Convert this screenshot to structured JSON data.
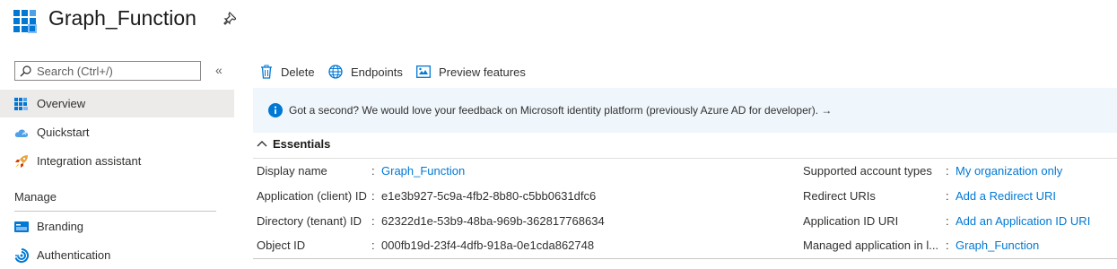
{
  "header": {
    "title": "Graph_Function"
  },
  "search": {
    "placeholder": "Search (Ctrl+/)"
  },
  "sidebar": {
    "items": [
      {
        "label": "Overview",
        "icon": "grid-icon",
        "active": true
      },
      {
        "label": "Quickstart",
        "icon": "cloud-icon"
      },
      {
        "label": "Integration assistant",
        "icon": "rocket-icon"
      }
    ],
    "manage_heading": "Manage",
    "manage_items": [
      {
        "label": "Branding",
        "icon": "branding-icon"
      },
      {
        "label": "Authentication",
        "icon": "authentication-icon"
      }
    ]
  },
  "toolbar": {
    "delete_label": "Delete",
    "endpoints_label": "Endpoints",
    "preview_label": "Preview features"
  },
  "banner": {
    "text": "Got a second? We would love your feedback on Microsoft identity platform (previously Azure AD for developer). →"
  },
  "essentials": {
    "heading": "Essentials",
    "left": [
      {
        "label": "Display name",
        "value": "Graph_Function",
        "link": true
      },
      {
        "label": "Application (client) ID",
        "value": "e1e3b927-5c9a-4fb2-8b80-c5bb0631dfc6",
        "link": false
      },
      {
        "label": "Directory (tenant) ID",
        "value": "62322d1e-53b9-48ba-969b-362817768634",
        "link": false
      },
      {
        "label": "Object ID",
        "value": "000fb19d-23f4-4dfb-918a-0e1cda862748",
        "link": false
      }
    ],
    "right": [
      {
        "label": "Supported account types",
        "value": "My organization only",
        "link": true
      },
      {
        "label": "Redirect URIs",
        "value": "Add a Redirect URI",
        "link": true
      },
      {
        "label": "Application ID URI",
        "value": "Add an Application ID URI",
        "link": true
      },
      {
        "label": "Managed application in l...",
        "value": "Graph_Function",
        "link": true
      }
    ]
  },
  "colors": {
    "accent": "#0078d4",
    "banner_bg": "#eff6fc",
    "active_nav_bg": "#edebe9"
  }
}
